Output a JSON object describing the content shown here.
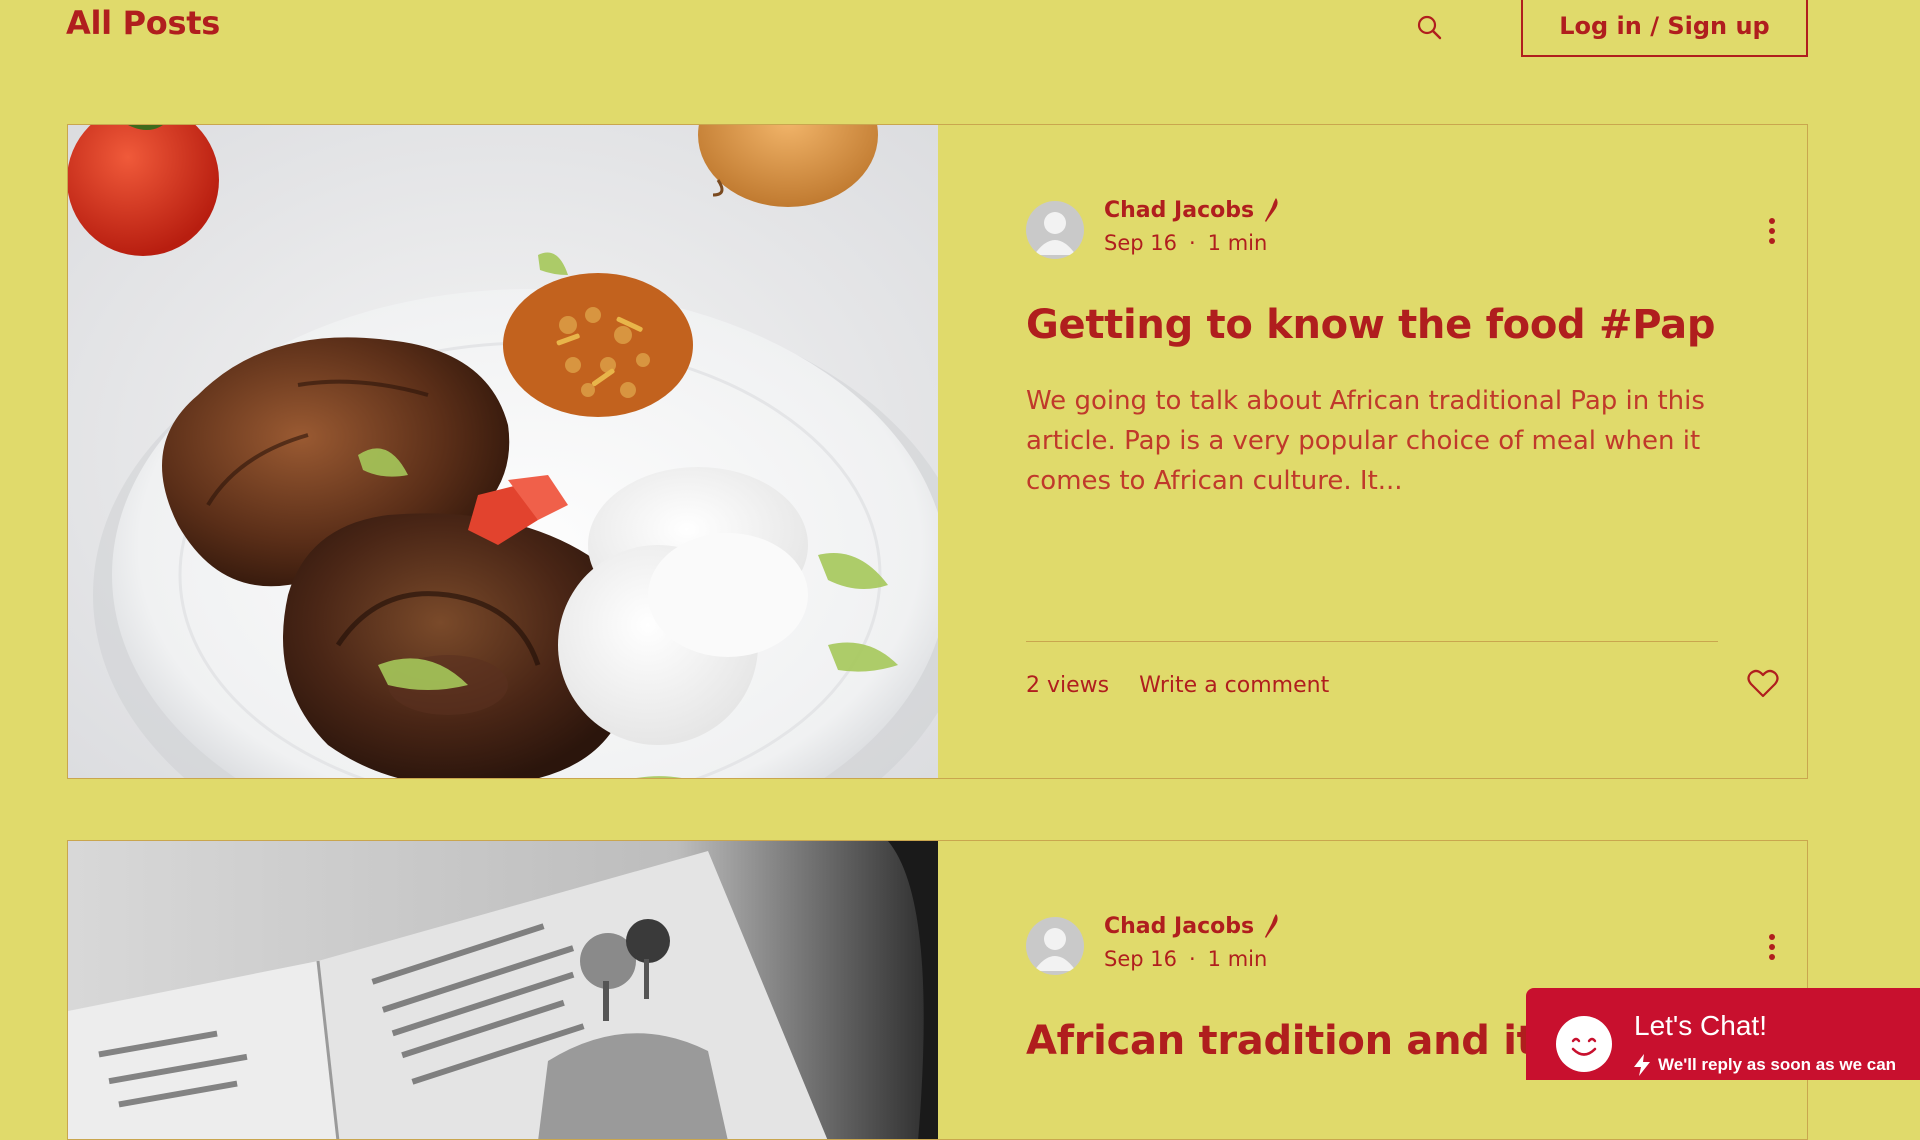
{
  "header": {
    "title": "All Posts",
    "login_label": "Log in / Sign up",
    "search_icon": "search-icon"
  },
  "posts": [
    {
      "author": "Chad Jacobs",
      "date": "Sep 16",
      "separator": "·",
      "read_time": "1 min",
      "title": "Getting to know the food #Pap",
      "excerpt": "We going to talk about African traditional Pap in this article. Pap is a very popular choice of meal when it comes to African culture. It...",
      "views": "2 views",
      "comment_label": "Write a comment",
      "image": "plate-with-grilled-meat-and-pap"
    },
    {
      "author": "Chad Jacobs",
      "date": "Sep 16",
      "separator": "·",
      "read_time": "1 min",
      "title": "African tradition and it's",
      "image": "open-book-black-and-white"
    }
  ],
  "chat": {
    "title": "Let's Chat!",
    "subtitle": "We'll reply as soon as we can"
  },
  "colors": {
    "background": "#E0DA6B",
    "text_primary": "#B01E1E",
    "chat_background": "#C8102E"
  }
}
